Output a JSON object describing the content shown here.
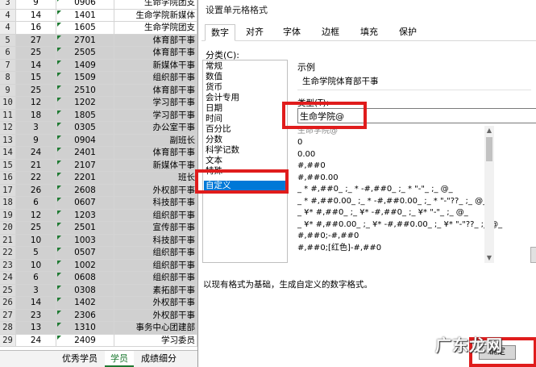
{
  "sheet": {
    "rows": [
      {
        "row": "3",
        "a": "9",
        "b": "0906",
        "c": "生命学院团支",
        "hl": false
      },
      {
        "row": "4",
        "a": "14",
        "b": "1401",
        "c": "生命学院新媒体",
        "hl": false
      },
      {
        "row": "4",
        "a": "16",
        "b": "1605",
        "c": "生命学院团支",
        "hl": false
      },
      {
        "row": "5",
        "a": "27",
        "b": "2701",
        "c": "体育部干事",
        "hl": true
      },
      {
        "row": "6",
        "a": "25",
        "b": "2505",
        "c": "体育部干事",
        "hl": true
      },
      {
        "row": "7",
        "a": "14",
        "b": "1409",
        "c": "新媒体干事",
        "hl": true
      },
      {
        "row": "8",
        "a": "15",
        "b": "1509",
        "c": "组织部干事",
        "hl": true
      },
      {
        "row": "9",
        "a": "25",
        "b": "2510",
        "c": "体育部干事",
        "hl": true
      },
      {
        "row": "10",
        "a": "12",
        "b": "1202",
        "c": "学习部干事",
        "hl": true
      },
      {
        "row": "11",
        "a": "18",
        "b": "1805",
        "c": "学习部干事",
        "hl": true
      },
      {
        "row": "12",
        "a": "3",
        "b": "0305",
        "c": "办公室干事",
        "hl": true
      },
      {
        "row": "13",
        "a": "9",
        "b": "0904",
        "c": "副班长",
        "hl": true
      },
      {
        "row": "14",
        "a": "24",
        "b": "2401",
        "c": "体育部干事",
        "hl": true
      },
      {
        "row": "15",
        "a": "21",
        "b": "2107",
        "c": "新媒体干事",
        "hl": true
      },
      {
        "row": "16",
        "a": "22",
        "b": "2201",
        "c": "班长",
        "hl": true
      },
      {
        "row": "17",
        "a": "26",
        "b": "2608",
        "c": "外权部干事",
        "hl": true
      },
      {
        "row": "18",
        "a": "6",
        "b": "0607",
        "c": "科技部干事",
        "hl": true
      },
      {
        "row": "19",
        "a": "12",
        "b": "1203",
        "c": "组织部干事",
        "hl": true
      },
      {
        "row": "20",
        "a": "25",
        "b": "2501",
        "c": "宣传部干事",
        "hl": true
      },
      {
        "row": "21",
        "a": "10",
        "b": "1003",
        "c": "科技部干事",
        "hl": true
      },
      {
        "row": "22",
        "a": "5",
        "b": "0507",
        "c": "组织部干事",
        "hl": true
      },
      {
        "row": "23",
        "a": "10",
        "b": "1002",
        "c": "组织部干事",
        "hl": true
      },
      {
        "row": "24",
        "a": "6",
        "b": "0608",
        "c": "组织部干事",
        "hl": true
      },
      {
        "row": "25",
        "a": "3",
        "b": "0308",
        "c": "素拓部干事",
        "hl": true
      },
      {
        "row": "26",
        "a": "14",
        "b": "1402",
        "c": "外权部干事",
        "hl": true
      },
      {
        "row": "27",
        "a": "23",
        "b": "2306",
        "c": "外权部干事",
        "hl": true
      },
      {
        "row": "28",
        "a": "13",
        "b": "1310",
        "c": "事务中心团建部",
        "hl": true
      },
      {
        "row": "29",
        "a": "24",
        "b": "2409",
        "c": "学习委员",
        "hl": false
      }
    ],
    "tabs": [
      "优秀学员",
      "学员",
      "成绩细分"
    ],
    "active_tab": "学员"
  },
  "dialog": {
    "title": "设置单元格格式",
    "tabs": [
      "数字",
      "对齐",
      "字体",
      "边框",
      "填充",
      "保护"
    ],
    "active_tab": "数字",
    "category_label": "分类(C):",
    "categories": [
      "常规",
      "数值",
      "货币",
      "会计专用",
      "日期",
      "时间",
      "百分比",
      "分数",
      "科学记数",
      "文本",
      "特殊",
      "自定义"
    ],
    "selected_category": "自定义",
    "sample_label": "示例",
    "sample_value": "生命学院体育部干事",
    "type_label": "类型(T):",
    "type_value": "生命学院@",
    "type_overlap_text": "生命学院@",
    "format_list": [
      "0",
      "0.00",
      "#,##0",
      "#,##0.00",
      "_ * #,##0_ ;_ * -#,##0_ ;_ * \"-\"_ ;_ @_",
      "_ * #,##0.00_ ;_ * -#,##0.00_ ;_ * \"-\"??_ ;_ @_",
      "_ ¥* #,##0_ ;_ ¥* -#,##0_ ;_ ¥* \"-\"_ ;_ @_",
      "_ ¥* #,##0.00_ ;_ ¥* -#,##0.00_ ;_ ¥* \"-\"??_ ;_ @_",
      "#,##0;-#,##0",
      "#,##0;[红色]-#,##0"
    ],
    "hint": "以现有格式为基础，生成自定义的数字格式。",
    "ok_label": "确定"
  },
  "watermark": "广东龙网",
  "colors": {
    "highlight": "#e01c1c",
    "selection": "#0078d7",
    "sheet_tab_active": "#1e7a32"
  }
}
